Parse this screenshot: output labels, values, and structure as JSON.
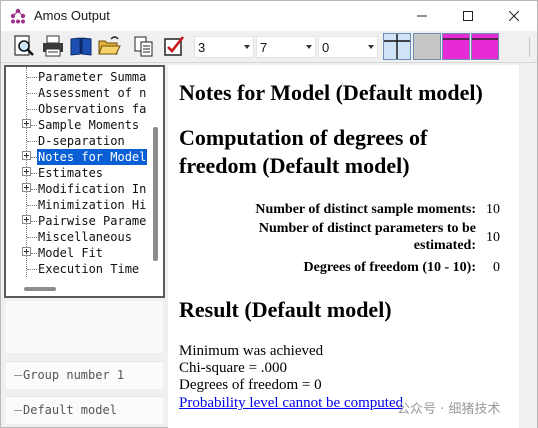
{
  "window": {
    "title": "Amos Output"
  },
  "toolbar": {
    "spin1": "3",
    "spin2": "7",
    "spin3": "0"
  },
  "tree": {
    "items": [
      {
        "label": "Parameter Summa",
        "expandable": false
      },
      {
        "label": "Assessment of n",
        "expandable": false
      },
      {
        "label": "Observations fa",
        "expandable": false
      },
      {
        "label": "Sample Moments",
        "expandable": true
      },
      {
        "label": "D-separation",
        "expandable": false
      },
      {
        "label": "Notes for Model",
        "expandable": true,
        "selected": true
      },
      {
        "label": "Estimates",
        "expandable": true
      },
      {
        "label": "Modification In",
        "expandable": true
      },
      {
        "label": "Minimization Hi",
        "expandable": false
      },
      {
        "label": "Pairwise Parame",
        "expandable": true
      },
      {
        "label": "Miscellaneous",
        "expandable": false
      },
      {
        "label": "Model Fit",
        "expandable": true
      },
      {
        "label": "Execution Time",
        "expandable": false
      }
    ]
  },
  "groups": {
    "group_label": "Group number 1",
    "model_label": "Default model"
  },
  "content": {
    "heading1": "Notes for Model (Default model)",
    "heading2": "Computation of degrees of freedom (Default model)",
    "stats": [
      {
        "label": "Number of distinct sample moments:",
        "value": "10"
      },
      {
        "label": "Number of distinct parameters to be estimated:",
        "value": "10"
      },
      {
        "label": "Degrees of freedom (10 - 10):",
        "value": "0"
      }
    ],
    "heading3": "Result (Default model)",
    "result_lines": [
      "Minimum was achieved",
      "Chi-square = .000",
      "Degrees of freedom = 0"
    ],
    "link": "Probability level cannot be computed"
  },
  "watermark": "公众号 · 细猪技术"
}
